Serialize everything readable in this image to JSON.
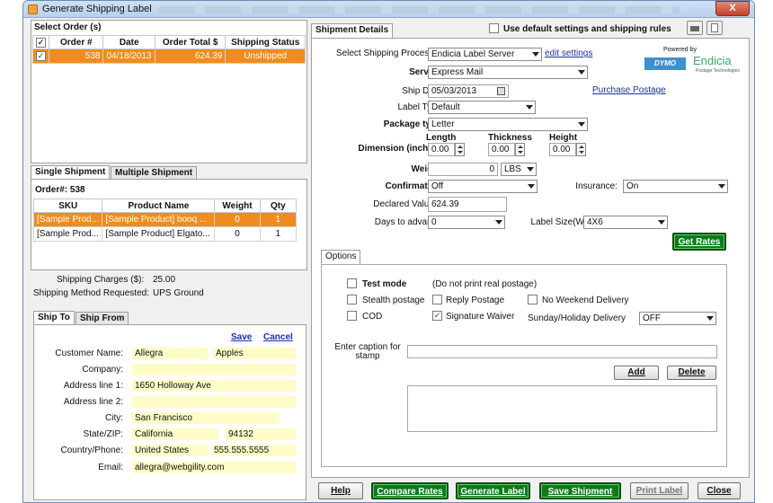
{
  "window": {
    "title": "Generate Shipping Label",
    "close": "X"
  },
  "orders": {
    "heading": "Select Order (s)",
    "columns": [
      "Order #",
      "Date",
      "Order Total $",
      "Shipping Status"
    ],
    "rows": [
      {
        "order": "538",
        "date": "04/18/2013",
        "total": "624.39",
        "status": "Unshipped",
        "checked": "✓"
      }
    ]
  },
  "shipment_tabs": {
    "single": "Single Shipment",
    "multiple": "Multiple Shipment"
  },
  "items": {
    "order_label": "Order#: 538",
    "columns": [
      "SKU",
      "Product Name",
      "Weight",
      "Qty"
    ],
    "rows": [
      {
        "sku": "[Sample Prod...",
        "name": "[Sample Product] booq ...",
        "weight": "0",
        "qty": "1"
      },
      {
        "sku": "[Sample Prod...",
        "name": "[Sample Product] Elgato...",
        "weight": "0",
        "qty": "1"
      }
    ]
  },
  "charges": {
    "shipping_label": "Shipping Charges ($):",
    "shipping_value": "25.00",
    "method_label": "Shipping Method Requested:",
    "method_value": "UPS Ground"
  },
  "address_tabs": {
    "ship_to": "Ship To",
    "ship_from": "Ship From"
  },
  "address": {
    "save": "Save",
    "cancel": "Cancel",
    "customer_name_label": "Customer Name:",
    "first_name": "Allegra",
    "last_name": "Apples",
    "company_label": "Company:",
    "company": "",
    "address1_label": "Address line 1:",
    "address1": "1650 Holloway Ave",
    "address2_label": "Address line 2:",
    "address2": "",
    "city_label": "City:",
    "city": "San Francisco",
    "state_label": "State/ZIP:",
    "state": "California",
    "zip": "94132",
    "country_label": "Country/Phone:",
    "country": "United States",
    "phone": "555.555.5555",
    "email_label": "Email:",
    "email": "allegra@webgility.com"
  },
  "shipment": {
    "tab": "Shipment Details",
    "default_settings_label": "Use default settings and shipping rules",
    "processor_label": "Select Shipping Processor:",
    "processor_value": "Endicia Label Server",
    "edit_settings": "edit settings",
    "powered_by": "Powered by",
    "dymo": "DYMO",
    "endicia": "Endicia",
    "endicia_sub": "Postage Technologies",
    "service_label": "Service:",
    "service_value": "Express Mail",
    "ship_date_label": "Ship Date:",
    "ship_date_value": "05/03/2013",
    "purchase_postage": "Purchase Postage",
    "label_type_label": "Label Type:",
    "label_type_value": "Default",
    "package_type_label": "Package type:",
    "package_type_value": "Letter",
    "dimension_label": "Dimension (inches):",
    "length_label": "Length",
    "length_value": "0.00",
    "thickness_label": "Thickness",
    "thickness_value": "0.00",
    "height_label": "Height",
    "height_value": "0.00",
    "weight_label": "Weight:",
    "weight_value": "0",
    "weight_unit": "LBS",
    "confirmation_label": "Confirmation:",
    "confirmation_value": "Off",
    "insurance_label": "Insurance:",
    "insurance_value": "On",
    "declared_label": "Declared Value $:",
    "declared_value": "624.39",
    "days_label": "Days to advance:",
    "days_value": "0",
    "label_size_label": "Label Size(WXH):",
    "label_size_value": "4X6",
    "get_rates": "Get Rates"
  },
  "options": {
    "tab": "Options",
    "test_mode": "Test mode",
    "test_mode_note": "(Do not print real postage)",
    "stealth": "Stealth postage",
    "reply": "Reply Postage",
    "no_weekend": "No Weekend Delivery",
    "cod": "COD",
    "signature": "Signature Waiver",
    "signature_check": "✓",
    "sunday_label": "Sunday/Holiday Delivery",
    "sunday_value": "OFF",
    "caption_label": "Enter caption for stamp",
    "add": "Add",
    "delete": "Delete"
  },
  "footer": {
    "help": "Help",
    "compare_rates": "Compare Rates",
    "generate_label": "Generate Label",
    "save_shipment": "Save Shipment",
    "print_label": "Print Label",
    "close": "Close"
  },
  "colors": {
    "selection": "#f08c1e",
    "green_button": "#0c7a1c",
    "link": "#1a2fa8",
    "field_highlight": "#fffcc8"
  }
}
